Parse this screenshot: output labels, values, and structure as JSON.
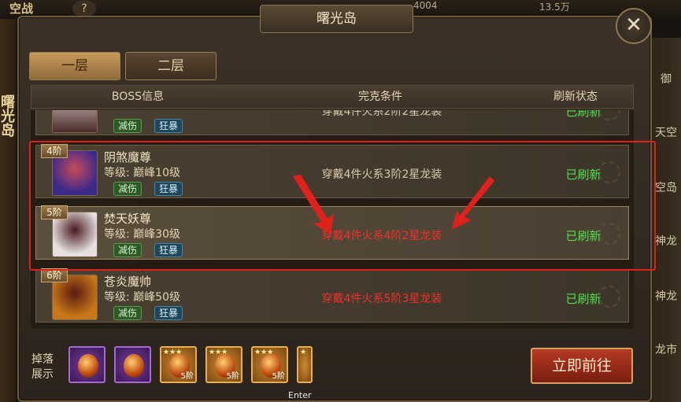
{
  "background": {
    "left_title": "空战",
    "help_icon": "question-icon",
    "resources": [
      "4004",
      "13.5万"
    ],
    "right_items": [
      "御",
      "天空",
      "空岛",
      "神龙",
      "神龙",
      "龙市"
    ],
    "left_vertical": "曙光岛"
  },
  "dialog": {
    "title": "曙光岛",
    "close_icon": "close-icon",
    "tabs": [
      {
        "label": "一层",
        "active": true
      },
      {
        "label": "二层",
        "active": false
      }
    ],
    "headers": {
      "boss": "BOSS信息",
      "condition": "完克条件",
      "status": "刷新状态"
    },
    "rows": [
      {
        "tier": "",
        "name": "",
        "level": "",
        "tags": [
          "减伤",
          "狂暴"
        ],
        "condition": "穿戴4件火系2阶2星龙装",
        "condition_color": "#d6c8ac",
        "status": "已刷新",
        "partial": true
      },
      {
        "tier": "4阶",
        "name": "阴煞魔尊",
        "level": "等级:  巅峰10级",
        "tags": [
          "减伤",
          "狂暴"
        ],
        "condition": "穿戴4件火系3阶2星龙装",
        "condition_color": "#d6c8ac",
        "status": "已刷新",
        "portrait": [
          "#3a2a8a",
          "#c84a5a"
        ]
      },
      {
        "tier": "5阶",
        "name": "焚天妖尊",
        "level": "等级:  巅峰30级",
        "tags": [
          "减伤",
          "狂暴"
        ],
        "condition": "穿戴4件火系4阶2星龙装",
        "condition_color": "#f0302a",
        "status": "已刷新",
        "portrait": [
          "#e6e0e0",
          "#4a1a20"
        ],
        "selected": true
      },
      {
        "tier": "6阶",
        "name": "苍炎魔帅",
        "level": "等级:  巅峰50级",
        "tags": [
          "减伤",
          "狂暴"
        ],
        "condition": "穿戴4件火系5阶3星龙装",
        "condition_color": "#f0302a",
        "status": "已刷新",
        "portrait": [
          "#c8781a",
          "#5a1a10"
        ]
      }
    ],
    "drop_label": "掉落展示",
    "drops": [
      {
        "rarity": "purple",
        "tier": ""
      },
      {
        "rarity": "purple",
        "tier": ""
      },
      {
        "rarity": "orange",
        "tier": "5阶"
      },
      {
        "rarity": "orange",
        "tier": "5阶"
      },
      {
        "rarity": "orange",
        "tier": "5阶"
      },
      {
        "rarity": "orange",
        "tier": ""
      }
    ],
    "go_button": "立即前往"
  },
  "annotation": {
    "box_color": "#e0201a",
    "enter_hint": "Enter"
  }
}
